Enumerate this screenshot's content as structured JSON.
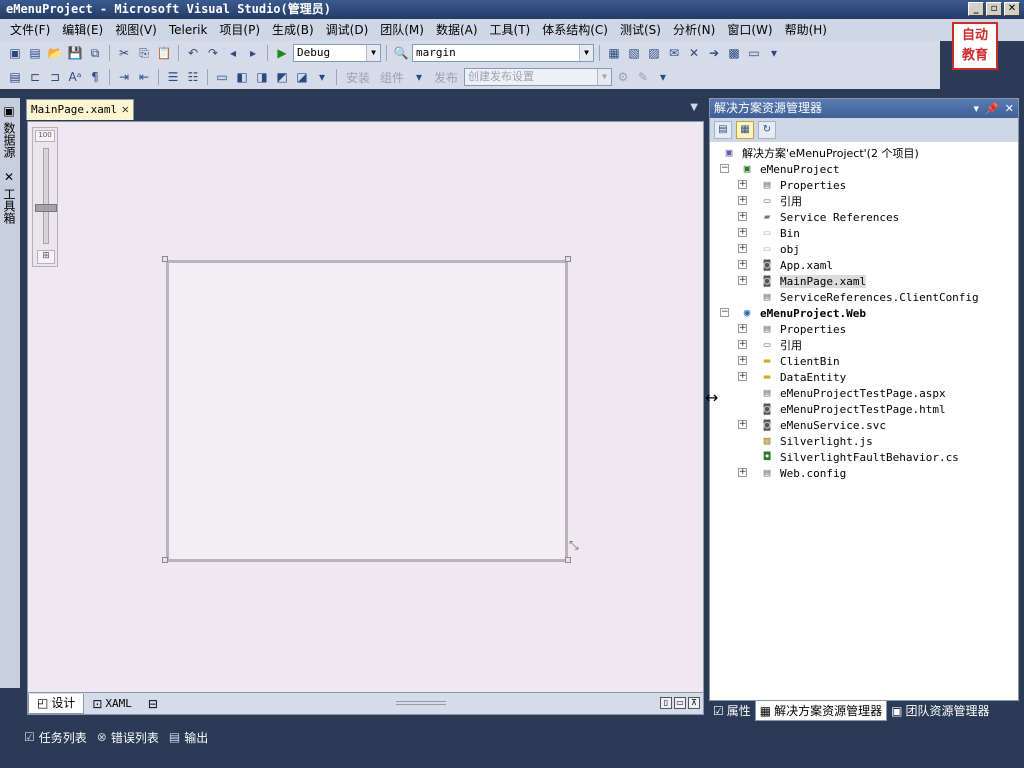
{
  "window": {
    "title": "eMenuProject - Microsoft Visual Studio(管理员)",
    "controls": [
      "_",
      "▫",
      "✕"
    ]
  },
  "menu": [
    "文件(F)",
    "编辑(E)",
    "视图(V)",
    "Telerik",
    "项目(P)",
    "生成(B)",
    "调试(D)",
    "团队(M)",
    "数据(A)",
    "工具(T)",
    "体系结构(C)",
    "测试(S)",
    "分析(N)",
    "窗口(W)",
    "帮助(H)"
  ],
  "toolbar1": {
    "config_combo": "Debug",
    "find_combo": "margin"
  },
  "toolbar2": {
    "dim_items": [
      "安装",
      "组件",
      "发布"
    ],
    "publish_combo": "创建发布设置"
  },
  "logo": {
    "line1": "自动",
    "line2": "教育"
  },
  "leftbar": {
    "tab1": "数据源",
    "tab2": "工具箱"
  },
  "doc_tab": {
    "label": "MainPage.xaml"
  },
  "zoom": {
    "label": "100"
  },
  "designbar": {
    "design_tab": "设计",
    "xaml_tab": "XAML"
  },
  "output_tabs": [
    "任务列表",
    "错误列表",
    "输出"
  ],
  "solution_explorer": {
    "title": "解决方案资源管理器",
    "solution_label": "解决方案'eMenuProject'(2 个项目)",
    "project1": "eMenuProject",
    "project1_items": [
      "Properties",
      "引用",
      "Service References",
      "Bin",
      "obj",
      "App.xaml",
      "MainPage.xaml",
      "ServiceReferences.ClientConfig"
    ],
    "project2": "eMenuProject.Web",
    "project2_items": [
      "Properties",
      "引用",
      "ClientBin",
      "DataEntity",
      "eMenuProjectTestPage.aspx",
      "eMenuProjectTestPage.html",
      "eMenuService.svc",
      "Silverlight.js",
      "SilverlightFaultBehavior.cs",
      "Web.config"
    ]
  },
  "bottom_tabs": [
    "属性",
    "解决方案资源管理器",
    "团队资源管理器"
  ]
}
